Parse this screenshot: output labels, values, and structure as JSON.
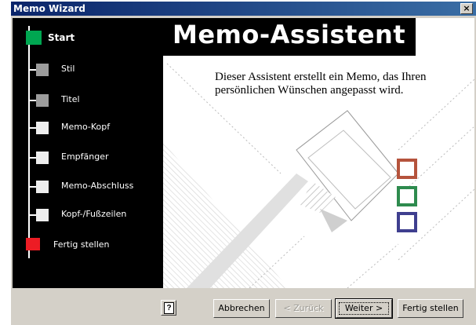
{
  "window": {
    "title": "Memo Wizard",
    "close_glyph": "×"
  },
  "sidebar": {
    "steps": [
      {
        "label": "Start",
        "state": "current",
        "color": "#00a651"
      },
      {
        "label": "Stil",
        "state": "upcoming",
        "color": "#9c9c9c"
      },
      {
        "label": "Titel",
        "state": "upcoming",
        "color": "#9c9c9c"
      },
      {
        "label": "Memo-Kopf",
        "state": "upcoming",
        "color": "#eeeeee"
      },
      {
        "label": "Empfänger",
        "state": "upcoming",
        "color": "#eeeeee"
      },
      {
        "label": "Memo-Abschluss",
        "state": "upcoming",
        "color": "#eeeeee"
      },
      {
        "label": "Kopf-/Fußzeilen",
        "state": "upcoming",
        "color": "#eeeeee"
      },
      {
        "label": "Fertig stellen",
        "state": "final",
        "color": "#ed1c24"
      }
    ]
  },
  "content": {
    "title": "Memo-Assistent",
    "description": "Dieser Assistent erstellt ein Memo, das Ihren persönlichen Wünschen angepasst wird.",
    "deco_square_colors": [
      "#b5533c",
      "#2e8b4e",
      "#3f3f8f"
    ]
  },
  "footer": {
    "help_glyph": "?",
    "cancel_label": "Abbrechen",
    "back_label": "< Zurück",
    "next_label": "Weiter >",
    "finish_label": "Fertig stellen"
  }
}
